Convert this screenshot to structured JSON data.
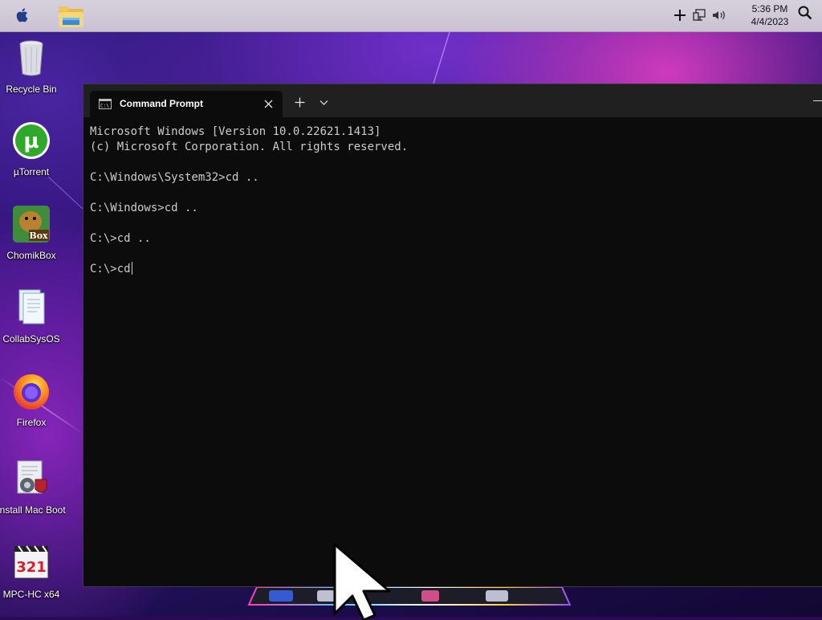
{
  "menubar": {
    "clock_time": "5:36 PM",
    "clock_date": "4/4/2023",
    "icons": [
      "apple-icon",
      "file-explorer-icon",
      "plus-icon",
      "network-icon",
      "volume-icon",
      "search-icon"
    ]
  },
  "desktop": {
    "icons": [
      {
        "label": "Recycle Bin",
        "icon": "recycle-bin-icon"
      },
      {
        "label": "µTorrent",
        "icon": "utorrent-icon"
      },
      {
        "label": "ChomikBox",
        "icon": "chomikbox-icon"
      },
      {
        "label": "CollabSysOS",
        "icon": "document-icon"
      },
      {
        "label": "Firefox",
        "icon": "firefox-icon"
      },
      {
        "label": "Install Mac Boot",
        "icon": "installer-icon"
      },
      {
        "label": "MPC-HC x64",
        "icon": "media-player-icon"
      }
    ]
  },
  "terminal": {
    "tab_title": "Command Prompt",
    "lines": [
      "Microsoft Windows [Version 10.0.22621.1413]",
      "(c) Microsoft Corporation. All rights reserved.",
      "",
      "C:\\Windows\\System32>cd ..",
      "",
      "C:\\Windows>cd ..",
      "",
      "C:\\>cd ..",
      "",
      "C:\\>cd"
    ]
  },
  "colors": {
    "terminal_bg": "#0c0c0c",
    "terminal_text": "#cccccc",
    "titlebar_bg": "#202020",
    "menubar_bg": "#d7d1dc"
  }
}
